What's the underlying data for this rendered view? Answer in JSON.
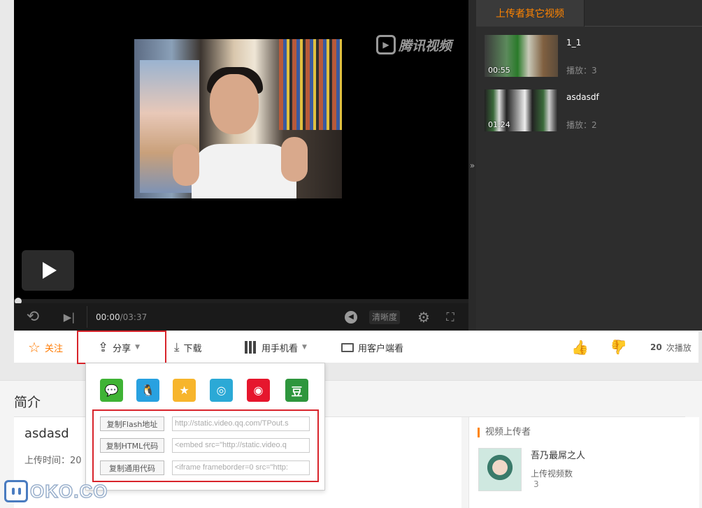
{
  "player": {
    "watermark": "腾讯视频",
    "time_current": "00:00",
    "time_total": "/03:37",
    "quality_label": "清晰度",
    "progress": 0,
    "expand_glyph": "»"
  },
  "sidebar": {
    "tab_label": "上传者其它视频",
    "items": [
      {
        "title": "1_1",
        "duration": "00:55",
        "plays": "播放：3"
      },
      {
        "title": "asdasdf",
        "duration": "01:24",
        "plays": "播放：2"
      }
    ]
  },
  "actions": {
    "follow": "关注",
    "share": "分享",
    "download": "下载",
    "mobile": "用手机看",
    "client": "用客户端看",
    "play_count": "20",
    "play_count_suffix": " 次播放"
  },
  "share_popup": {
    "icons": [
      "wechat-icon",
      "qq-icon",
      "qzone-icon",
      "pengyou-icon",
      "weibo-icon",
      "douban-icon"
    ],
    "douban_glyph": "豆",
    "rows": [
      {
        "button": "复制Flash地址",
        "value": "http://static.video.qq.com/TPout.s"
      },
      {
        "button": "复制HTML代码",
        "value": "<embed src=\"http://static.video.q"
      },
      {
        "button": "复制通用代码",
        "value": "<iframe frameborder=0 src=\"http:"
      }
    ]
  },
  "intro": {
    "heading": "简介",
    "video_title": "asdasd",
    "upload_time": "上传时间：20"
  },
  "uploader": {
    "heading": "视频上传者",
    "name": "吾乃最屌之人",
    "count_label": "上传视频数",
    "count": "3"
  },
  "logo": {
    "text": "OKO.CO"
  },
  "colors": {
    "accent": "#ff8400",
    "highlight": "#d8242b"
  }
}
